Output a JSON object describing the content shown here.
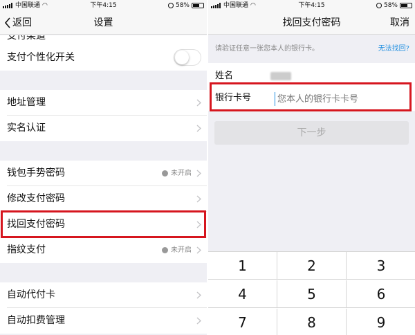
{
  "left": {
    "status": {
      "carrier": "中国联通",
      "time": "下午4:15",
      "battery": "58%"
    },
    "nav": {
      "back": "返回",
      "title": "设置"
    },
    "cells": {
      "partial": "支付渠道",
      "toggle_label": "支付个性化开关",
      "address": "地址管理",
      "realname": "实名认证",
      "gesture": "钱包手势密码",
      "gesture_status": "未开启",
      "modify_pwd": "修改支付密码",
      "recover_pwd": "找回支付密码",
      "fingerprint": "指纹支付",
      "fingerprint_status": "未开启",
      "auto_card": "自动代付卡",
      "auto_deduct": "自动扣费管理"
    },
    "toggle_on": false
  },
  "right": {
    "status": {
      "carrier": "中国联通",
      "time": "下午4:15",
      "battery": "58%"
    },
    "nav": {
      "title": "找回支付密码",
      "cancel": "取消"
    },
    "hint": "请验证任意一张您本人的银行卡。",
    "hint_link": "无法找回?",
    "name_label": "姓名",
    "card_label": "银行卡号",
    "card_placeholder": "您本人的银行卡卡号",
    "next": "下一步",
    "keys": [
      "1",
      "2",
      "3",
      "4",
      "5",
      "6",
      "7",
      "8",
      "9"
    ]
  },
  "colors": {
    "highlight": "#d6161f",
    "link": "#1e8ee0"
  }
}
